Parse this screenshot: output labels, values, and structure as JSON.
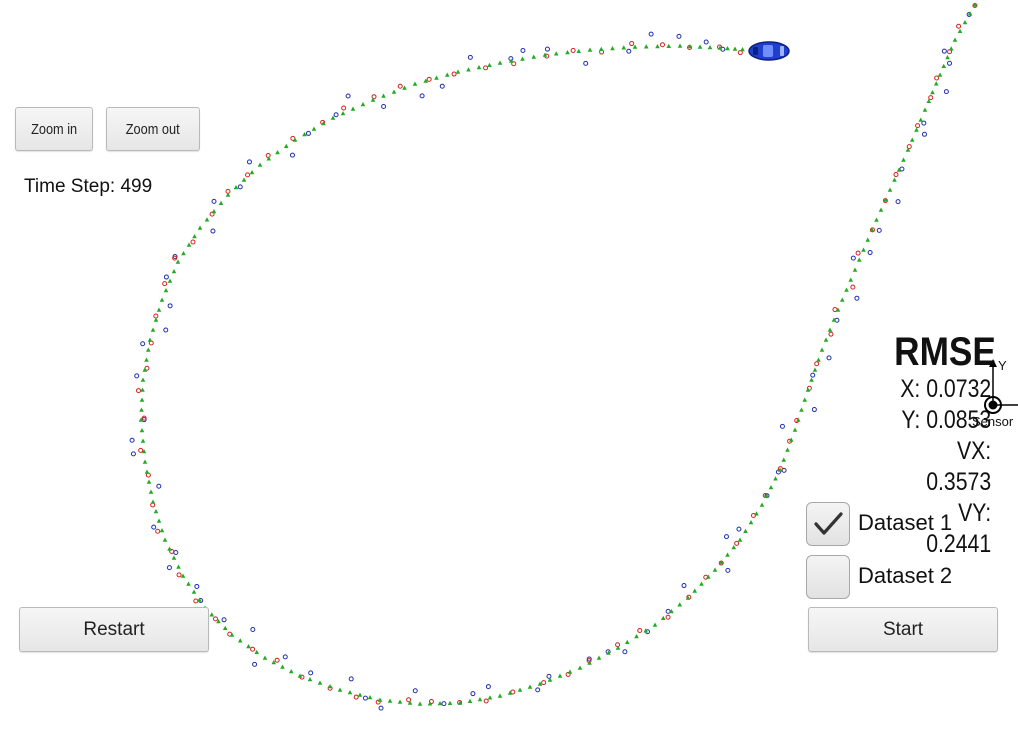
{
  "controls": {
    "zoom_in_label": "Zoom in",
    "zoom_out_label": "Zoom out",
    "restart_label": "Restart",
    "start_label": "Start"
  },
  "status": {
    "time_step_text": "Time Step: 499"
  },
  "rmse": {
    "title": "RMSE",
    "x_text": "X: 0.0732",
    "y_text": "Y: 0.0853",
    "vx_text": "VX: 0.3573",
    "vy_text": "VY: 0.2441"
  },
  "datasets": [
    {
      "label": "Dataset 1",
      "checked": true
    },
    {
      "label": "Dataset 2",
      "checked": false
    }
  ],
  "sensor": {
    "label": "Sensor",
    "axis_y_label": "Y"
  },
  "colors": {
    "ground_truth": "#22aa22",
    "lidar": "#d42020",
    "radar": "#1f2fb0",
    "car": "#1f3fd0"
  },
  "icons": {
    "car": "car-icon",
    "check": "checkmark-icon"
  }
}
